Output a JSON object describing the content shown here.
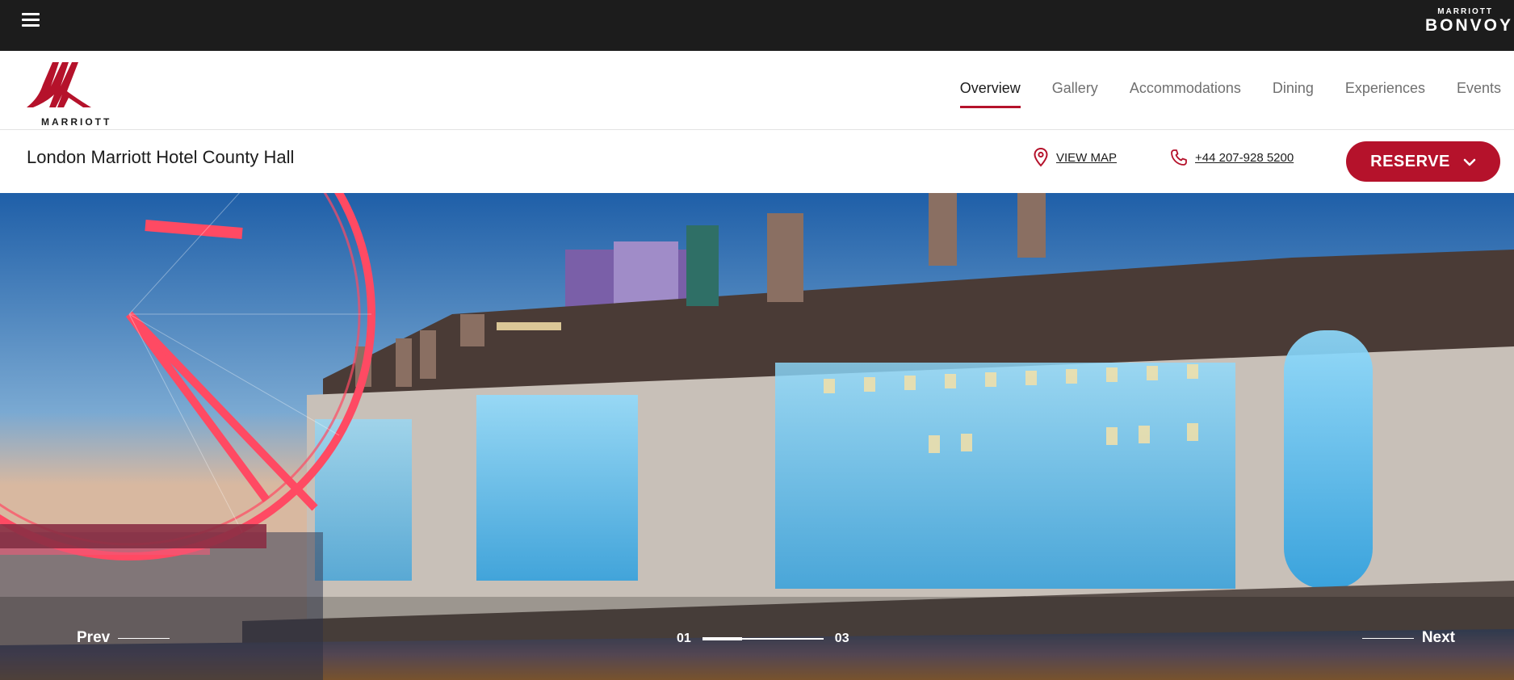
{
  "topbar": {
    "menu_icon": "hamburger-menu-icon",
    "bonvoy_small": "MARRIOTT",
    "bonvoy_big": "BONVOY"
  },
  "brand": {
    "wordmark": "MARRIOTT",
    "color": "#b5122b"
  },
  "nav": {
    "items": [
      {
        "label": "Overview",
        "active": true
      },
      {
        "label": "Gallery",
        "active": false
      },
      {
        "label": "Accommodations",
        "active": false
      },
      {
        "label": "Dining",
        "active": false
      },
      {
        "label": "Experiences",
        "active": false
      },
      {
        "label": "Events",
        "active": false
      }
    ]
  },
  "info": {
    "hotel_name": "London Marriott Hotel County Hall",
    "view_map": "VIEW MAP",
    "phone": "+44 207-928 5200",
    "reserve": "RESERVE"
  },
  "carousel": {
    "prev": "Prev",
    "next": "Next",
    "current": "01",
    "total": "03",
    "progress": 0.33
  }
}
